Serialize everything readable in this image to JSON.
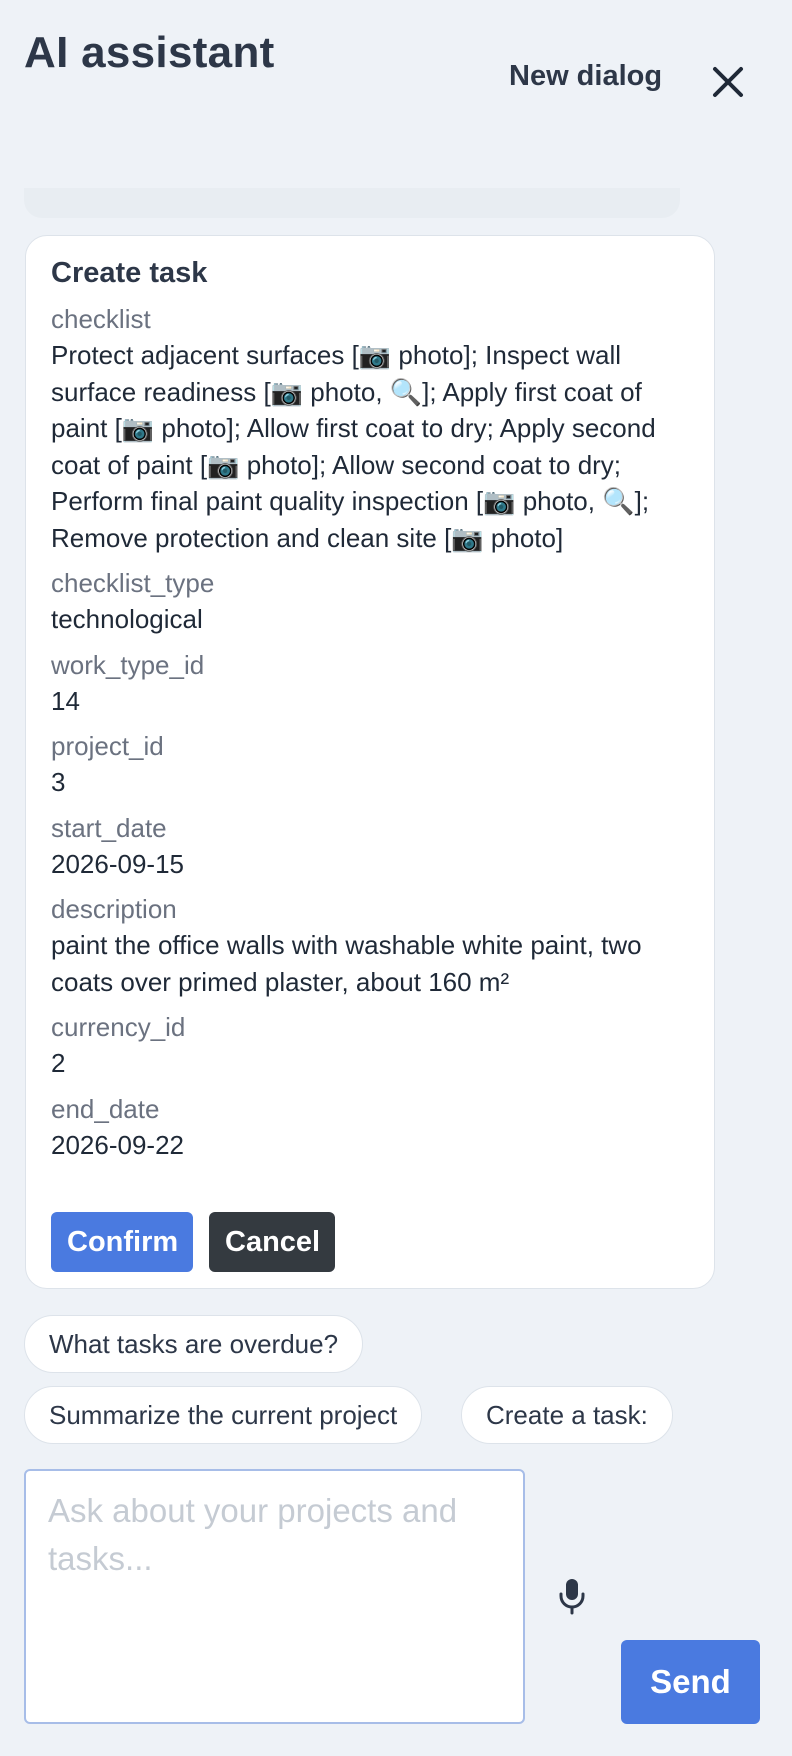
{
  "header": {
    "title": "AI assistant",
    "new_dialog_label": "New dialog",
    "close_icon": "close-icon"
  },
  "task_card": {
    "title": "Create task",
    "fields": [
      {
        "label": "checklist",
        "value": "Protect adjacent surfaces [📷 photo]; Inspect wall surface readiness [📷 photo, 🔍]; Apply first coat of paint [📷 photo]; Allow first coat to dry; Apply second coat of paint [📷 photo]; Allow second coat to dry; Perform final paint quality inspection [📷 photo, 🔍]; Remove protection and clean site [📷 photo]"
      },
      {
        "label": "checklist_type",
        "value": "technological"
      },
      {
        "label": "work_type_id",
        "value": "14"
      },
      {
        "label": "project_id",
        "value": "3"
      },
      {
        "label": "start_date",
        "value": "2026-09-15"
      },
      {
        "label": "description",
        "value": "paint the office walls with washable white paint, two coats over primed plaster, about 160 m²"
      },
      {
        "label": "currency_id",
        "value": "2"
      },
      {
        "label": "end_date",
        "value": "2026-09-22"
      }
    ],
    "confirm_label": "Confirm",
    "cancel_label": "Cancel"
  },
  "suggestions": [
    "What tasks are overdue?",
    "Summarize the current project",
    "Create a task:"
  ],
  "composer": {
    "placeholder": "Ask about your projects and tasks...",
    "value": "",
    "mic_icon": "microphone-icon",
    "send_label": "Send"
  },
  "colors": {
    "background": "#eef2f7",
    "accent": "#4a7ae0",
    "cancel": "#343a40"
  }
}
